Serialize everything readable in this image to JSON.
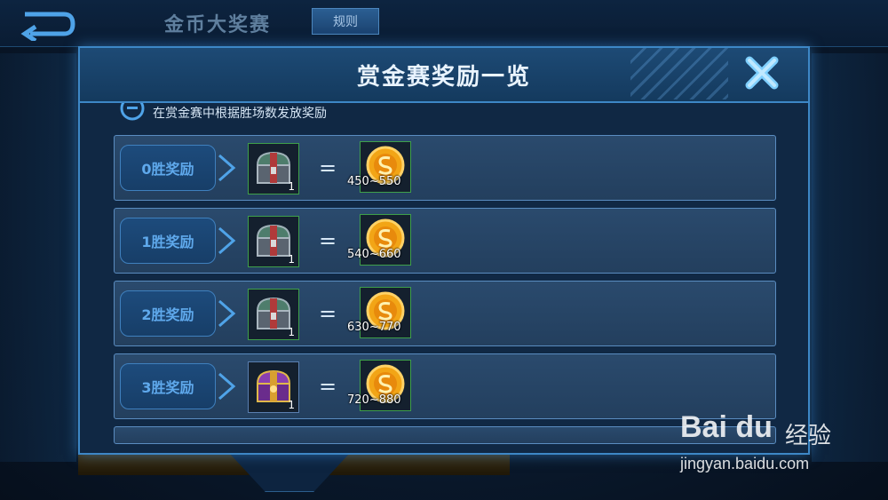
{
  "topbar": {
    "back_icon": "back-arrow-icon",
    "title": "金币大奖赛",
    "rules_label": "规则"
  },
  "modal": {
    "title": "赏金赛奖励一览",
    "close_icon": "close-x-icon",
    "subtitle": "在赏金赛中根据胜场数发放奖励",
    "rows": [
      {
        "label": "0胜奖励",
        "chest_count": "1",
        "chest_type": "silver-chest",
        "coin_range": "450~550"
      },
      {
        "label": "1胜奖励",
        "chest_count": "1",
        "chest_type": "silver-chest",
        "coin_range": "540~660"
      },
      {
        "label": "2胜奖励",
        "chest_count": "1",
        "chest_type": "silver-chest",
        "coin_range": "630~770"
      },
      {
        "label": "3胜奖励",
        "chest_count": "1",
        "chest_type": "purple-chest",
        "coin_range": "720~880"
      }
    ],
    "equals_sign": "="
  },
  "watermark": {
    "brand": "Bai du",
    "cn": "经验",
    "url": "jingyan.baidu.com"
  },
  "colors": {
    "accent_blue": "#3d87c6",
    "label_blue": "#5fa9ec",
    "slot_border_green": "#3fa04a",
    "coin_gold": "#f2a516"
  }
}
